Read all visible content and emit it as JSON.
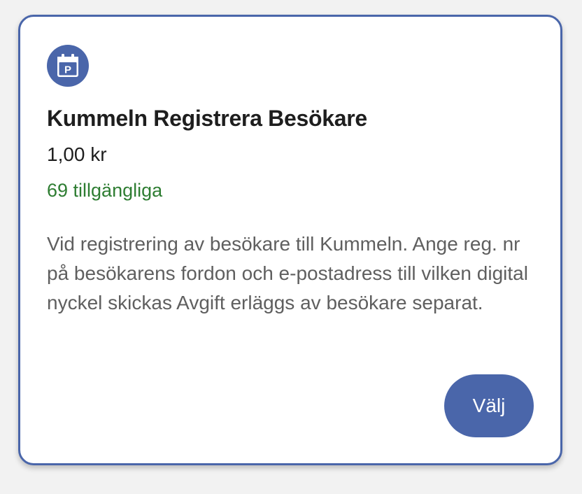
{
  "card": {
    "icon": "parking-calendar-icon",
    "icon_letter": "P",
    "title": "Kummeln Registrera Besökare",
    "price": "1,00 kr",
    "availability": "69 tillgängliga",
    "description": "Vid registrering av besökare till Kummeln. Ange reg. nr på besökarens fordon och e-postadress till vilken digital nyckel skickas Avgift erläggs av besökare separat.",
    "button_label": "Välj"
  },
  "colors": {
    "accent": "#4a66aa",
    "availability": "#2e7d32",
    "title": "#1e1e1e",
    "description": "#5f5f5f",
    "background": "#f2f2f2"
  }
}
